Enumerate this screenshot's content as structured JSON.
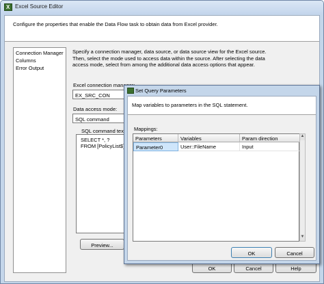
{
  "window": {
    "title": "Excel Source Editor",
    "header_text": "Configure the properties that enable the Data Flow task to obtain data from Excel provider."
  },
  "nav": {
    "items": [
      "Connection Manager",
      "Columns",
      "Error Output"
    ]
  },
  "main": {
    "description": "Specify a connection manager, data source, or data source view for the Excel source. Then, select the mode used to access data within the source. After selecting the data access mode, select from among the additional data access options that appear.",
    "connection_label": "Excel connection manager:",
    "connection_value": "EX_SRC_CON",
    "access_mode_label": "Data access mode:",
    "access_mode_value": "SQL command",
    "sql_label": "SQL command text:",
    "sql_line1": "SELECT *, ?",
    "sql_line2": "FROM [PolicyList$]",
    "preview_label": "Preview...",
    "ok_label": "OK",
    "cancel_label": "Cancel",
    "help_label": "Help"
  },
  "dialog": {
    "title": "Set Query Parameters",
    "header_text": "Map variables to parameters in the SQL statement.",
    "mappings_label": "Mappings:",
    "columns": [
      "Parameters",
      "Variables",
      "Param direction"
    ],
    "rows": [
      {
        "parameter": "Parameter0",
        "variable": "User::FileName",
        "direction": "Input"
      }
    ],
    "ok_label": "OK",
    "cancel_label": "Cancel"
  },
  "icons": {
    "app": "excel-source-icon",
    "dialog": "excel-source-icon"
  }
}
